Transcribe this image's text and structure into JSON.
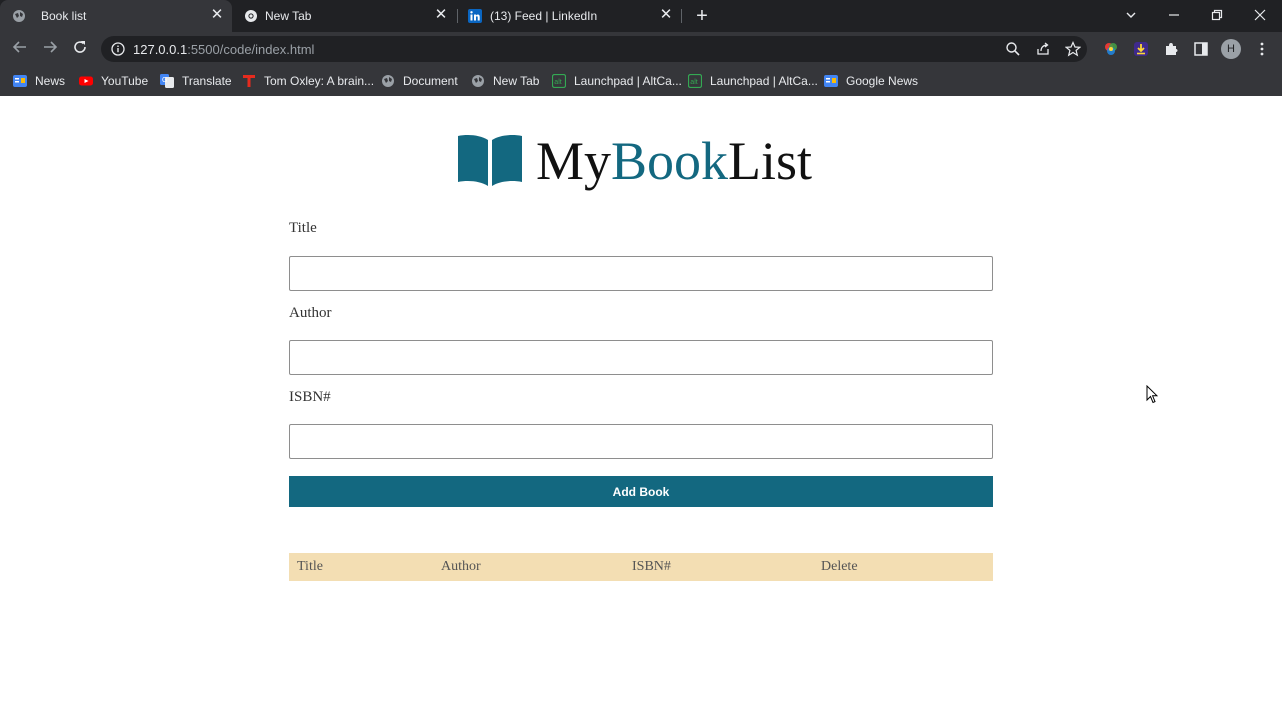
{
  "browser": {
    "tabs": [
      {
        "label": "Book list",
        "icon": "globe-icon",
        "active": true
      },
      {
        "label": "New Tab",
        "icon": "chrome-icon",
        "active": false
      },
      {
        "label": "(13) Feed | LinkedIn",
        "icon": "linkedin-icon",
        "active": false
      }
    ],
    "address": {
      "host": "127.0.0.1",
      "path": ":5500/code/index.html"
    },
    "profile_initial": "H",
    "bookmarks": [
      {
        "label": "News",
        "icon": "google-news-icon"
      },
      {
        "label": "YouTube",
        "icon": "youtube-icon"
      },
      {
        "label": "Translate",
        "icon": "google-translate-icon"
      },
      {
        "label": "Tom Oxley: A brain...",
        "icon": "ted-icon"
      },
      {
        "label": "Document",
        "icon": "globe-icon"
      },
      {
        "label": "New Tab",
        "icon": "globe-icon"
      },
      {
        "label": "Launchpad | AltCa...",
        "icon": "altcampus-icon"
      },
      {
        "label": "Launchpad | AltCa...",
        "icon": "altcampus-icon"
      },
      {
        "label": "Google News",
        "icon": "google-news-icon"
      }
    ]
  },
  "page": {
    "logo": {
      "text_prefix": "My",
      "text_accent": "Book",
      "text_suffix": "List"
    },
    "form": {
      "title_label": "Title",
      "title_value": "",
      "author_label": "Author",
      "author_value": "",
      "isbn_label": "ISBN#",
      "isbn_value": "",
      "submit_label": "Add Book"
    },
    "table": {
      "headers": [
        "Title",
        "Author",
        "ISBN#",
        "Delete"
      ],
      "rows": []
    }
  },
  "colors": {
    "brand": "#136880",
    "table_header": "#f3deb3",
    "chrome_dark": "#202124",
    "chrome_toolbar": "#35363a"
  }
}
